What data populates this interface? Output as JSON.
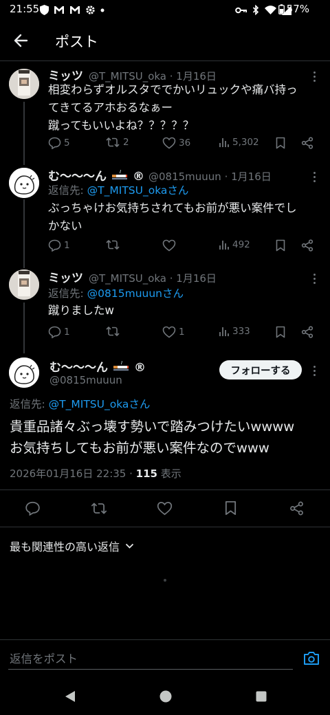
{
  "status_bar": {
    "time": "21:55",
    "battery": "57%"
  },
  "header": {
    "title": "ポスト"
  },
  "tweets": [
    {
      "name": "ミッツ",
      "handle_date": "@T_MITSU_oka · 1月16日",
      "reply_label": "",
      "reply_to": "",
      "lines": [
        "相変わらずオルスタででかいリュックや痛バ持っ",
        "てきてるアホおるなぁー",
        "蹴ってもいいよね？？？？？"
      ],
      "replies": "5",
      "reposts": "2",
      "likes": "36",
      "views": "5,302"
    },
    {
      "name": "む〜〜〜ん",
      "name_suffix": "®",
      "handle_date": "@0815muuun · 1月16日",
      "reply_label": "返信先: ",
      "reply_to": "@T_MITSU_okaさん",
      "lines": [
        "ぶっちゃけお気持ちされてもお前が悪い案件でし",
        "かない"
      ],
      "replies": "1",
      "reposts": "",
      "likes": "",
      "views": "492"
    },
    {
      "name": "ミッツ",
      "handle_date": "@T_MITSU_oka · 1月16日",
      "reply_label": "返信先: ",
      "reply_to": "@0815muuunさん",
      "lines": [
        "蹴りましたw"
      ],
      "replies": "1",
      "reposts": "",
      "likes": "1",
      "views": "333"
    }
  ],
  "main_post": {
    "name": "む〜〜〜ん",
    "name_suffix": "®",
    "handle": "@0815muuun",
    "follow_label": "フォローする",
    "reply_label": "返信先: ",
    "reply_to": "@T_MITSU_okaさん",
    "lines": [
      "貴重品諸々ぶっ壊す勢いで踏みつけたいwwww",
      "お気持ちしてもお前が悪い案件なのでwww"
    ],
    "datetime": "2026年01月16日 22:35 · ",
    "views_count": "115",
    "views_label": " 表示"
  },
  "relevance": {
    "label": "最も関連性の高い返信"
  },
  "reply_bar": {
    "placeholder": "返信をポスト"
  },
  "colors": {
    "accent": "#1d9bf0",
    "background": "#000000",
    "muted": "#71767b",
    "text": "#e7e9ea"
  }
}
